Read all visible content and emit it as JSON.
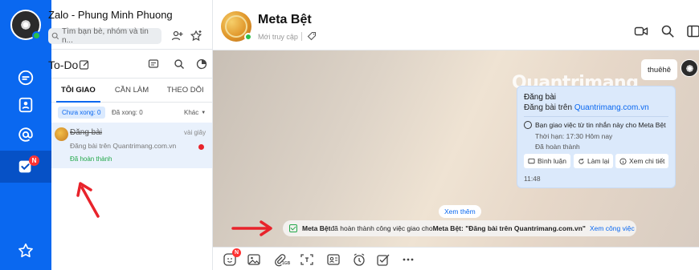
{
  "app": {
    "title": "Zalo - Phung Minh Phuong",
    "search_placeholder": "Tìm bạn bè, nhóm và tin n..."
  },
  "rail": {
    "items": [
      {
        "icon": "chat-icon"
      },
      {
        "icon": "contacts-icon"
      },
      {
        "icon": "at-icon"
      },
      {
        "icon": "todo-icon",
        "badge": "N",
        "active": true
      },
      {
        "icon": "star-icon"
      }
    ]
  },
  "todo": {
    "title": "To-Do",
    "tabs": [
      "TÔI GIAO",
      "CẦN LÀM",
      "THEO DÕI"
    ],
    "active_tab": "TÔI GIAO",
    "filters": {
      "unfinished": "Chưa xong: 0",
      "finished": "Đã xong: 0",
      "sort": "Khác"
    },
    "task": {
      "name": "Đăng bài",
      "time": "vài giây",
      "description": "Đăng bài trên Quantrimang.com.vn",
      "status": "Đã hoàn thành"
    }
  },
  "chat": {
    "name": "Meta Bệt",
    "status": "Mới truy cập",
    "watermark": "Quantrimang",
    "sent_message": "thuêhê",
    "task_card": {
      "title": "Đăng bài",
      "line_prefix": "Đăng bài trên ",
      "line_link": "Quantrimang.com.vn",
      "assigned": "Bạn giao việc từ tin nhắn này cho Meta Bệt",
      "due": "Thời hạn: 17:30 Hôm nay",
      "done": "Đã hoàn thành",
      "buttons": [
        "Bình luận",
        "Làm lại",
        "Xem chi tiết"
      ],
      "time": "11:48"
    },
    "see_more": "Xem thêm",
    "notice": {
      "actor": "Meta Bệt",
      "middle": " đã hoàn thành công việc giao cho ",
      "target": "Meta Bệt",
      "task": " : \"Đăng bài trên Quantrimang.com.vn\"",
      "link": "Xem công việc"
    },
    "toolbar": {
      "sticker_badge": "N",
      "file_size": "1GB"
    }
  },
  "colors": {
    "primary": "#0a68f0",
    "success": "#22a84a",
    "danger": "#e8232b"
  }
}
